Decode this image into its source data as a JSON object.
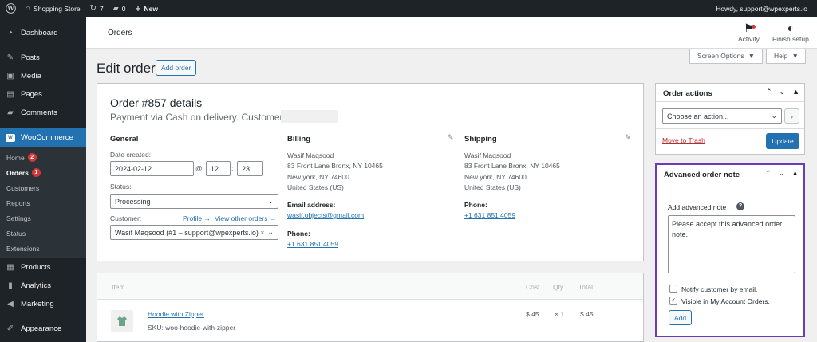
{
  "admin_bar": {
    "site_name": "Shopping Store",
    "updates_count": "7",
    "comments_count": "0",
    "new_label": "New",
    "howdy": "Howdy, support@wpexperts.io"
  },
  "sidebar": {
    "dashboard": "Dashboard",
    "posts": "Posts",
    "media": "Media",
    "pages": "Pages",
    "comments": "Comments",
    "woocommerce": "WooCommerce",
    "sub": {
      "home": "Home",
      "home_badge": "2",
      "orders": "Orders",
      "orders_badge": "1",
      "customers": "Customers",
      "reports": "Reports",
      "settings": "Settings",
      "status": "Status",
      "extensions": "Extensions"
    },
    "products": "Products",
    "analytics": "Analytics",
    "marketing": "Marketing",
    "appearance": "Appearance"
  },
  "header": {
    "title": "Orders",
    "activity": "Activity",
    "finish_setup": "Finish setup"
  },
  "screen_options": "Screen Options",
  "help": "Help",
  "page": {
    "title": "Edit order",
    "add_order": "Add order"
  },
  "order": {
    "heading": "Order #857 details",
    "subheading": "Payment via Cash on delivery. Customer IP:",
    "general": {
      "title": "General",
      "date_label": "Date created:",
      "date": "2024-02-12",
      "at": "@",
      "hour": "12",
      "colon": ":",
      "minute": "23",
      "status_label": "Status:",
      "status": "Processing",
      "customer_label": "Customer:",
      "profile_link": "Profile →",
      "other_orders_link": "View other orders →",
      "customer": "Wasif Maqsood (#1 – support@wpexperts.io)",
      "clear": "×"
    },
    "billing": {
      "title": "Billing",
      "name": "Wasif Maqsood",
      "line1": "83 Front Lane Bronx, NY 10465",
      "line2": "New york, NY 74600",
      "country": "United States (US)",
      "email_label": "Email address:",
      "email": "wasif.objects@gmail.com",
      "phone_label": "Phone:",
      "phone": "+1 631 851 4059"
    },
    "shipping": {
      "title": "Shipping",
      "name": "Wasif Maqsood",
      "line1": "83 Front Lane Bronx, NY 10465",
      "line2": "New york, NY 74600",
      "country": "United States (US)",
      "phone_label": "Phone:",
      "phone": "+1 631 851 4059"
    }
  },
  "items": {
    "headers": {
      "item": "Item",
      "cost": "Cost",
      "qty": "Qty",
      "total": "Total"
    },
    "rows": [
      {
        "name": "Hoodie with Zipper",
        "sku": "SKU: woo-hoodie-with-zipper",
        "cost": "$ 45",
        "qty": "× 1",
        "total": "$ 45"
      }
    ]
  },
  "order_actions": {
    "title": "Order actions",
    "select_placeholder": "Choose an action...",
    "go": "›",
    "trash": "Move to Trash",
    "update": "Update"
  },
  "advanced_note": {
    "title": "Advanced order note",
    "label": "Add advanced note",
    "text": "Please accept this advanced order note.",
    "notify": "Notify customer by email.",
    "visible": "Visible in My Account Orders.",
    "add": "Add"
  },
  "colors": {
    "accent": "#2271b1",
    "admin_dark": "#1d2327",
    "highlight_border": "#6c3bb6",
    "badge": "#d63638"
  }
}
